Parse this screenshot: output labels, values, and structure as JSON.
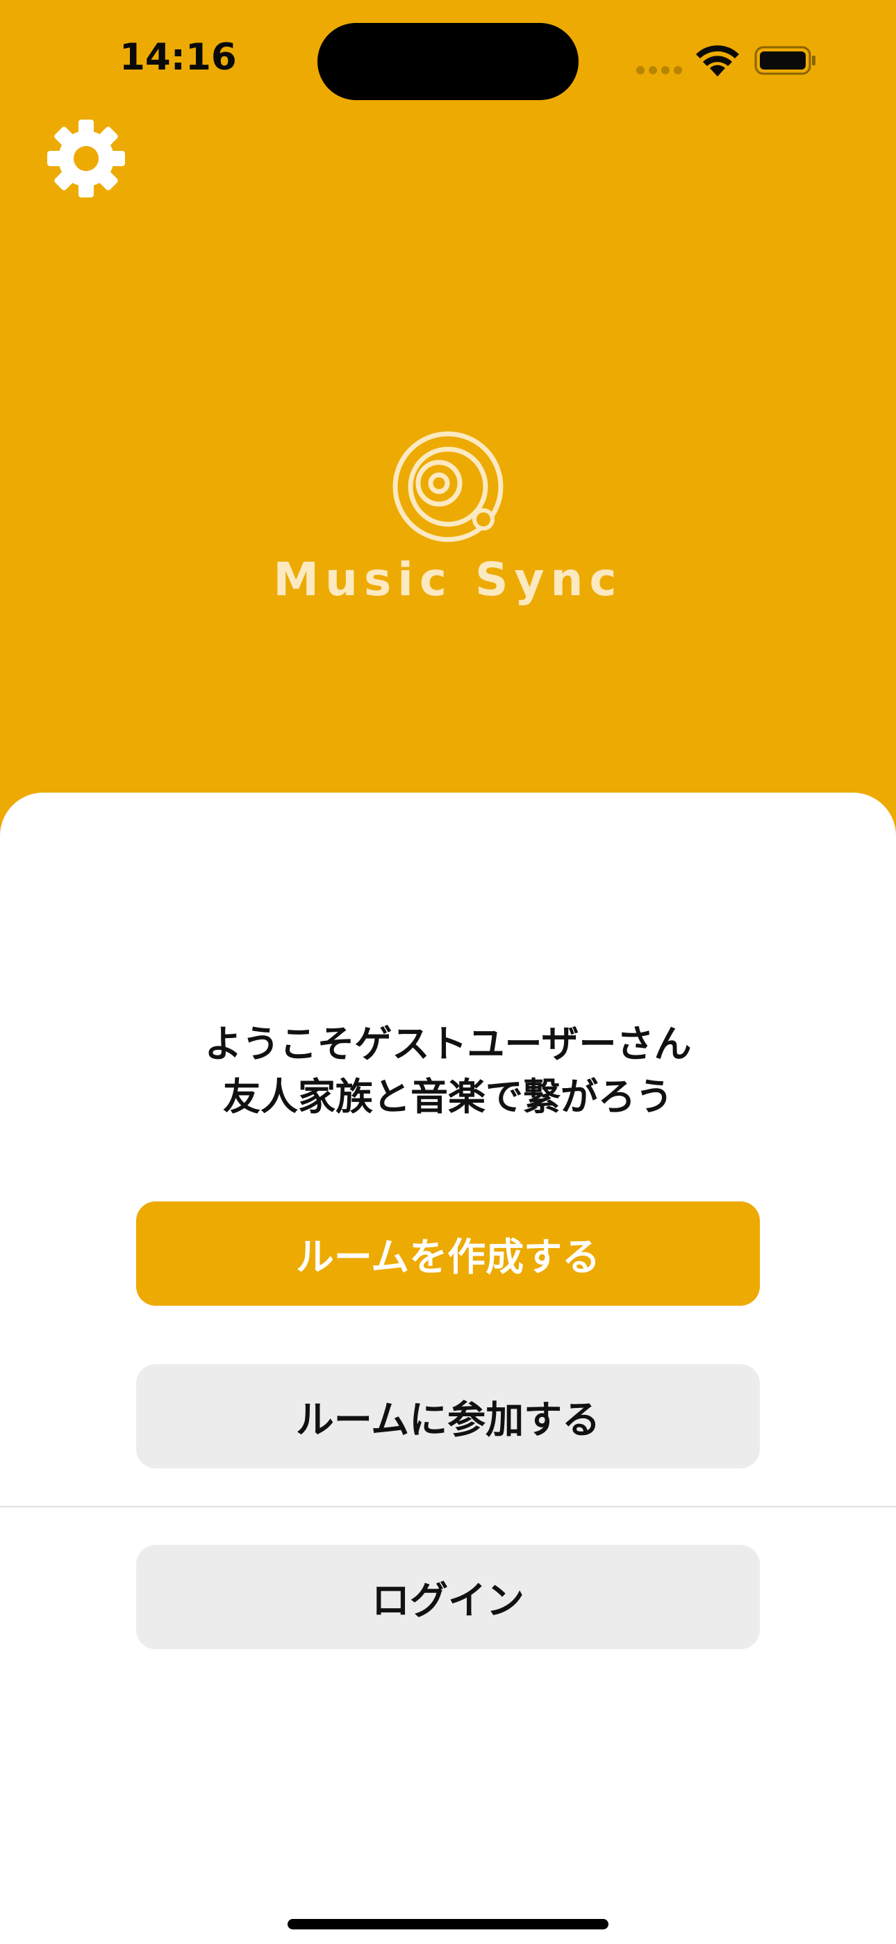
{
  "status_bar": {
    "time": "14:16"
  },
  "theme": {
    "accent": "#EDAA02",
    "secondary_button_bg": "#ECECEC",
    "sheet_bg": "#FFFFFF"
  },
  "header": {
    "settings_icon": "gear-icon"
  },
  "logo": {
    "icon": "orbit-music-icon",
    "text": "Music Sync"
  },
  "welcome": {
    "line1": "ようこそゲストユーザーさん",
    "line2": "友人家族と音楽で繋がろう"
  },
  "actions": {
    "create_room": "ルームを作成する",
    "join_room": "ルームに参加する",
    "login": "ログイン"
  }
}
